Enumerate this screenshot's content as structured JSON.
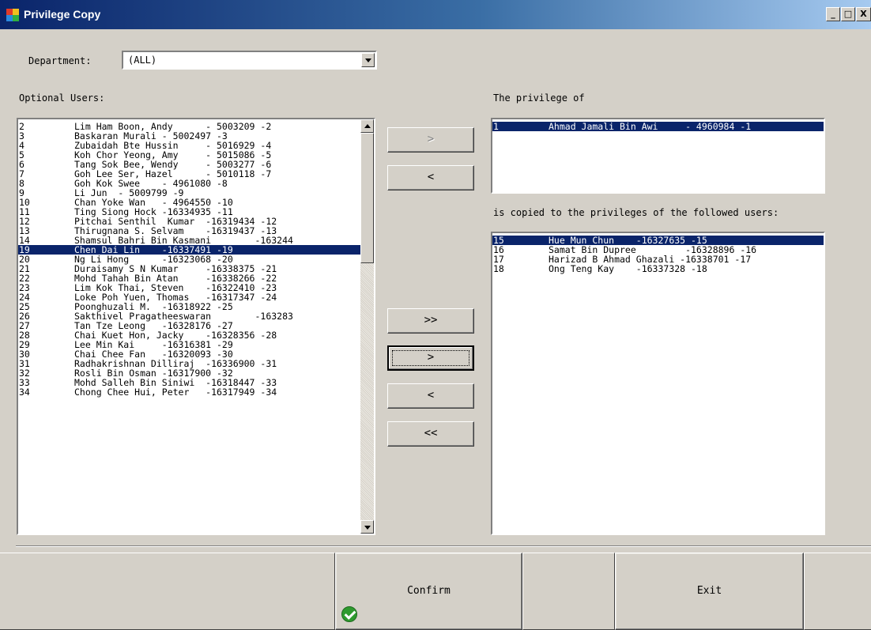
{
  "window": {
    "title": "Privilege Copy",
    "controls": {
      "minimize": "_",
      "maximize": "□",
      "close": "X"
    }
  },
  "department": {
    "label": "Department:",
    "selected": "(ALL)"
  },
  "optional_users": {
    "label": "Optional Users:",
    "items": [
      {
        "num": "2",
        "text": "Lim Ham Boon, Andy      - 5003209 -2"
      },
      {
        "num": "3",
        "text": "Baskaran Murali - 5002497 -3"
      },
      {
        "num": "4",
        "text": "Zubaidah Bte Hussin     - 5016929 -4"
      },
      {
        "num": "5",
        "text": "Koh Chor Yeong, Amy     - 5015086 -5"
      },
      {
        "num": "6",
        "text": "Tang Sok Bee, Wendy     - 5003277 -6"
      },
      {
        "num": "7",
        "text": "Goh Lee Ser, Hazel      - 5010118 -7"
      },
      {
        "num": "8",
        "text": "Goh Kok Swee    - 4961080 -8"
      },
      {
        "num": "9",
        "text": "Li Jun  - 5009799 -9"
      },
      {
        "num": "10",
        "text": "Chan Yoke Wan   - 4964550 -10"
      },
      {
        "num": "11",
        "text": "Ting Siong Hock -16334935 -11"
      },
      {
        "num": "12",
        "text": "Pitchai Senthil  Kumar  -16319434 -12"
      },
      {
        "num": "13",
        "text": "Thirugnana S. Selvam    -16319437 -13"
      },
      {
        "num": "14",
        "text": "Shamsul Bahri Bin Kasmani        -163244"
      },
      {
        "num": "19",
        "text": "Chen Dai Lin    -16337491 -19"
      },
      {
        "num": "20",
        "text": "Ng Li Hong      -16323068 -20"
      },
      {
        "num": "21",
        "text": "Duraisamy S N Kumar     -16338375 -21"
      },
      {
        "num": "22",
        "text": "Mohd Tahah Bin Atan     -16338266 -22"
      },
      {
        "num": "23",
        "text": "Lim Kok Thai, Steven    -16322410 -23"
      },
      {
        "num": "24",
        "text": "Loke Poh Yuen, Thomas   -16317347 -24"
      },
      {
        "num": "25",
        "text": "Poonghuzali M.  -16318922 -25"
      },
      {
        "num": "26",
        "text": "Sakthivel Pragatheeswaran        -163283"
      },
      {
        "num": "27",
        "text": "Tan Tze Leong   -16328176 -27"
      },
      {
        "num": "28",
        "text": "Chai Kuet Hon, Jacky    -16328356 -28"
      },
      {
        "num": "29",
        "text": "Lee Min Kai     -16316381 -29"
      },
      {
        "num": "30",
        "text": "Chai Chee Fan   -16320093 -30"
      },
      {
        "num": "31",
        "text": "Radhakrishnan Dilliraj  -16336900 -31"
      },
      {
        "num": "32",
        "text": "Rosli Bin Osman -16317900 -32"
      },
      {
        "num": "33",
        "text": "Mohd Salleh Bin Siniwi  -16318447 -33"
      },
      {
        "num": "34",
        "text": "Chong Chee Hui, Peter   -16317949 -34"
      }
    ],
    "selected_num": "19"
  },
  "source": {
    "label": "The privilege of",
    "items": [
      {
        "num": "1",
        "text": "Ahmad Jamali Bin Awi     - 4960984 -1"
      }
    ],
    "selected_num": "1"
  },
  "targets": {
    "label": "is copied to the privileges of the followed users:",
    "items": [
      {
        "num": "15",
        "text": "Hue Mun Chun    -16327635 -15"
      },
      {
        "num": "16",
        "text": "Samat Bin Dupree         -16328896 -16"
      },
      {
        "num": "17",
        "text": "Harizad B Ahmad Ghazali -16338701 -17"
      },
      {
        "num": "18",
        "text": "Ong Teng Kay    -16337328 -18"
      }
    ],
    "selected_num": "15"
  },
  "buttons": {
    "source_add": ">",
    "source_remove": "<",
    "add_all": ">>",
    "add_one": ">",
    "remove_one": "<",
    "remove_all": "<<",
    "confirm": "Confirm",
    "exit": "Exit"
  },
  "icons": {
    "confirm_icon": "check-circle-icon",
    "app_icon": "app-window-icon"
  },
  "colors": {
    "title_start": "#0a246a",
    "selection": "#0a246a",
    "face": "#d4d0c8",
    "ok_green": "#2e9a2e"
  }
}
